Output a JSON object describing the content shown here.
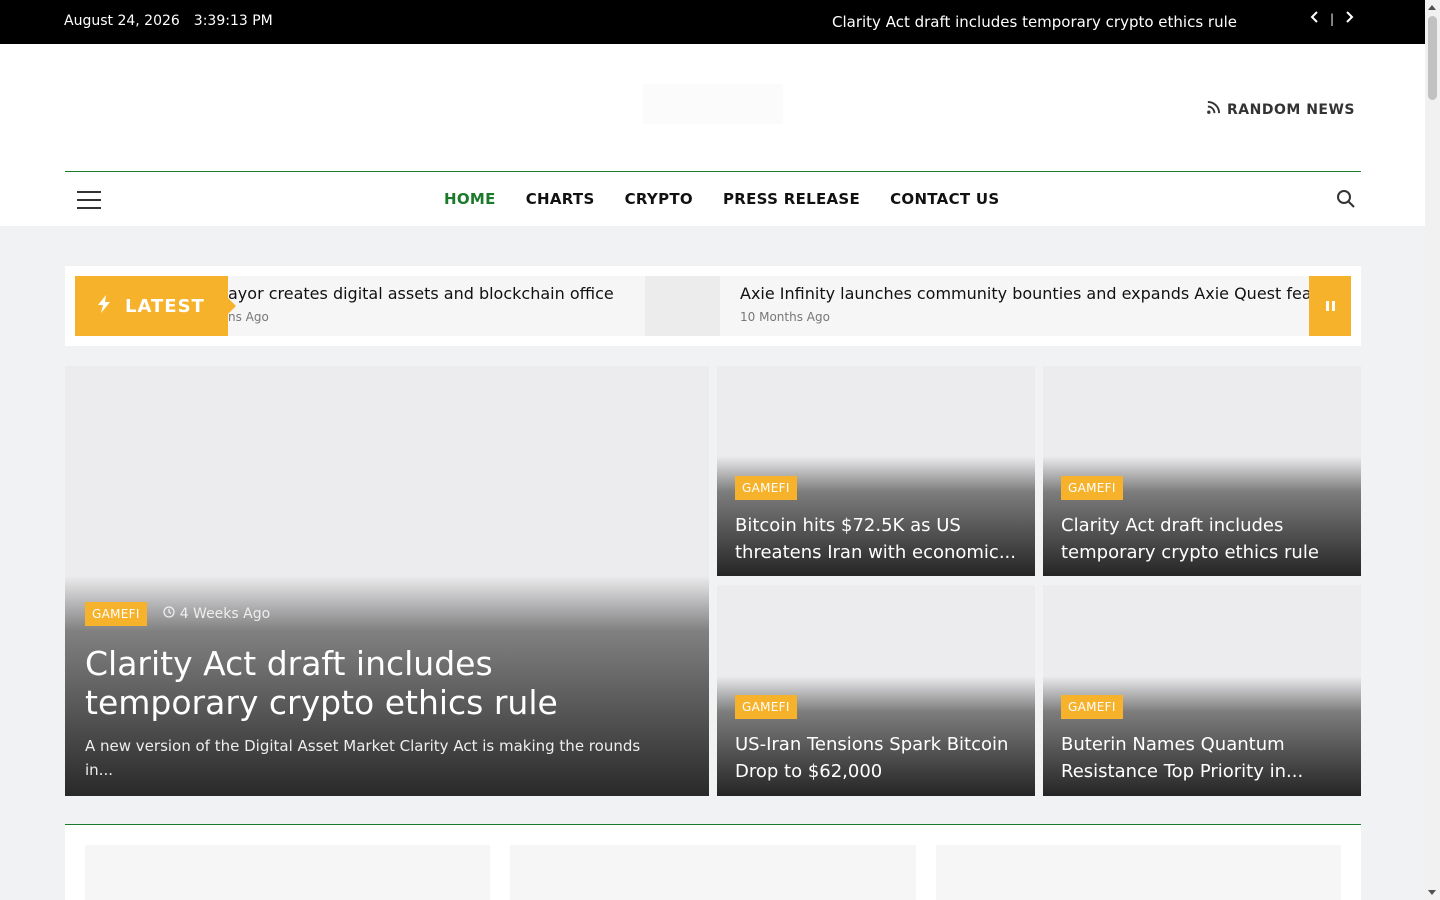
{
  "topbar": {
    "date": "August 24, 2026",
    "time": "3:39:13 PM",
    "ticker_headline": "Clarity Act draft includes temporary crypto ethics rule",
    "prev_label": "‹",
    "separator": "|",
    "next_label": "›"
  },
  "header": {
    "random_news_label": "RANDOM NEWS"
  },
  "nav": {
    "items": [
      {
        "label": "HOME"
      },
      {
        "label": "CHARTS"
      },
      {
        "label": "CRYPTO"
      },
      {
        "label": "PRESS RELEASE"
      },
      {
        "label": "CONTACT US"
      }
    ]
  },
  "latest": {
    "label": "LATEST",
    "items": [
      {
        "title": "ayor creates digital assets and blockchain office",
        "age": "ns Ago"
      },
      {
        "title": "Axie Infinity launches community bounties and expands Axie Quest fea",
        "age": "10 Months Ago"
      }
    ]
  },
  "featured": {
    "category": "GAMEFI",
    "age": "4 Weeks Ago",
    "title": "Clarity Act draft includes temporary crypto ethics rule",
    "excerpt": "A new version of the Digital Asset Market Clarity Act is making the rounds in..."
  },
  "cards": [
    {
      "category": "GAMEFI",
      "title": "Bitcoin hits $72.5K as US threatens Iran with economic..."
    },
    {
      "category": "GAMEFI",
      "title": "Clarity Act draft includes temporary crypto ethics rule"
    },
    {
      "category": "GAMEFI",
      "title": "US-Iran Tensions Spark Bitcoin Drop to $62,000"
    },
    {
      "category": "GAMEFI",
      "title": "Buterin Names Quantum Resistance Top Priority in..."
    }
  ],
  "colors": {
    "accent_green": "#1b7a2a",
    "badge_orange": "#f7b22c",
    "topbar_black": "#000000"
  }
}
